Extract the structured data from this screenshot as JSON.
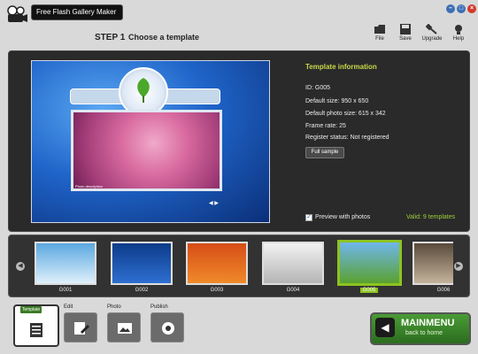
{
  "window": {
    "title": "Free Flash Gallery Maker"
  },
  "header": {
    "step_label": "STEP 1",
    "step_title": "Choose a template"
  },
  "toolbar": {
    "file": "File",
    "save": "Save",
    "upgrade": "Upgrade",
    "help": "Help"
  },
  "template_info": {
    "title": "Template information",
    "id": "ID: G005",
    "default_size": "Default size: 950 x 650",
    "photo_size": "Default photo size: 615 x 342",
    "frame_rate": "Frame rate: 25",
    "register_status": "Register status: Not registered",
    "full_sample": "Full sample",
    "preview_with_photos": "Preview with photos",
    "preview_checked": true,
    "valid": "Valid: 9 templates"
  },
  "thumbnails": [
    {
      "label": "G001"
    },
    {
      "label": "G002"
    },
    {
      "label": "G003"
    },
    {
      "label": "G004"
    },
    {
      "label": "G005",
      "selected": true
    },
    {
      "label": "G006"
    }
  ],
  "steps": {
    "template": "Template",
    "edit": "Edit",
    "photo": "Photo",
    "publish": "Publish"
  },
  "main_menu": {
    "title": "MAINMENU",
    "subtitle": "back to home"
  },
  "colors": {
    "accent_green": "#8ec321",
    "info_title": "#c9d84a"
  }
}
